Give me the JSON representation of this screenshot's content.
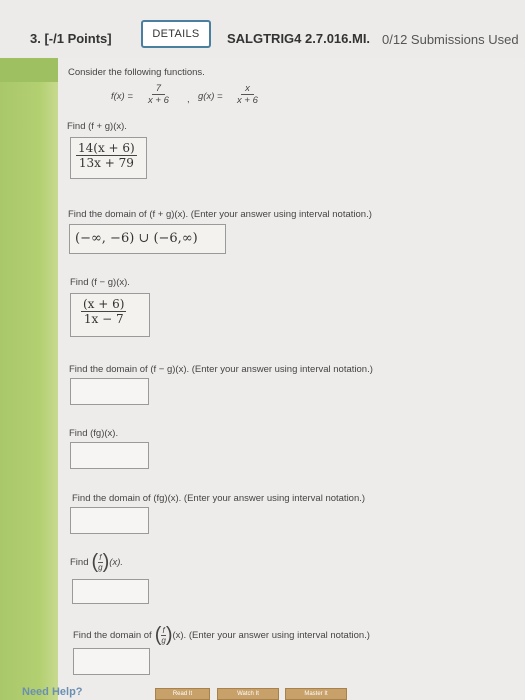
{
  "header": {
    "question_number": "3. [-/1 Points]",
    "details_label": "DETAILS",
    "question_id": "SALGTRIG4 2.7.016.MI.",
    "submissions": "0/12 Submissions Used"
  },
  "problem": {
    "intro": "Consider the following functions.",
    "f_label": "f(x) =",
    "f_num": "7",
    "f_den": "x + 6",
    "g_label": "g(x) =",
    "g_num": "x",
    "g_den": "x + 6",
    "comma": ","
  },
  "parts": {
    "p1_prompt": "Find (f + g)(x).",
    "p1_answer_num": "14(x + 6)",
    "p1_answer_den": "13x + 79",
    "p2_prompt": "Find the domain of (f + g)(x). (Enter your answer using interval notation.)",
    "p2_answer": "(−∞, −6) ∪ (−6,∞)",
    "p3_prompt": "Find (f − g)(x).",
    "p3_answer_num": "(x + 6)",
    "p3_answer_den": "1x − 7",
    "p4_prompt": "Find the domain of (f − g)(x). (Enter your answer using interval notation.)",
    "p5_prompt": "Find (fg)(x).",
    "p6_prompt": "Find the domain of (fg)(x). (Enter your answer using interval notation.)",
    "p7_prompt_pre": "Find",
    "p7_frac_num": "f",
    "p7_frac_den": "g",
    "p7_prompt_post": "(x).",
    "p8_prompt_pre": "Find the domain of",
    "p8_frac_num": "f",
    "p8_frac_den": "g",
    "p8_prompt_post": "(x). (Enter your answer using interval notation.)"
  },
  "footer": {
    "need_help": "Need Help?",
    "read_it": "Read It",
    "watch_it": "Watch It",
    "master_it": "Master It"
  }
}
